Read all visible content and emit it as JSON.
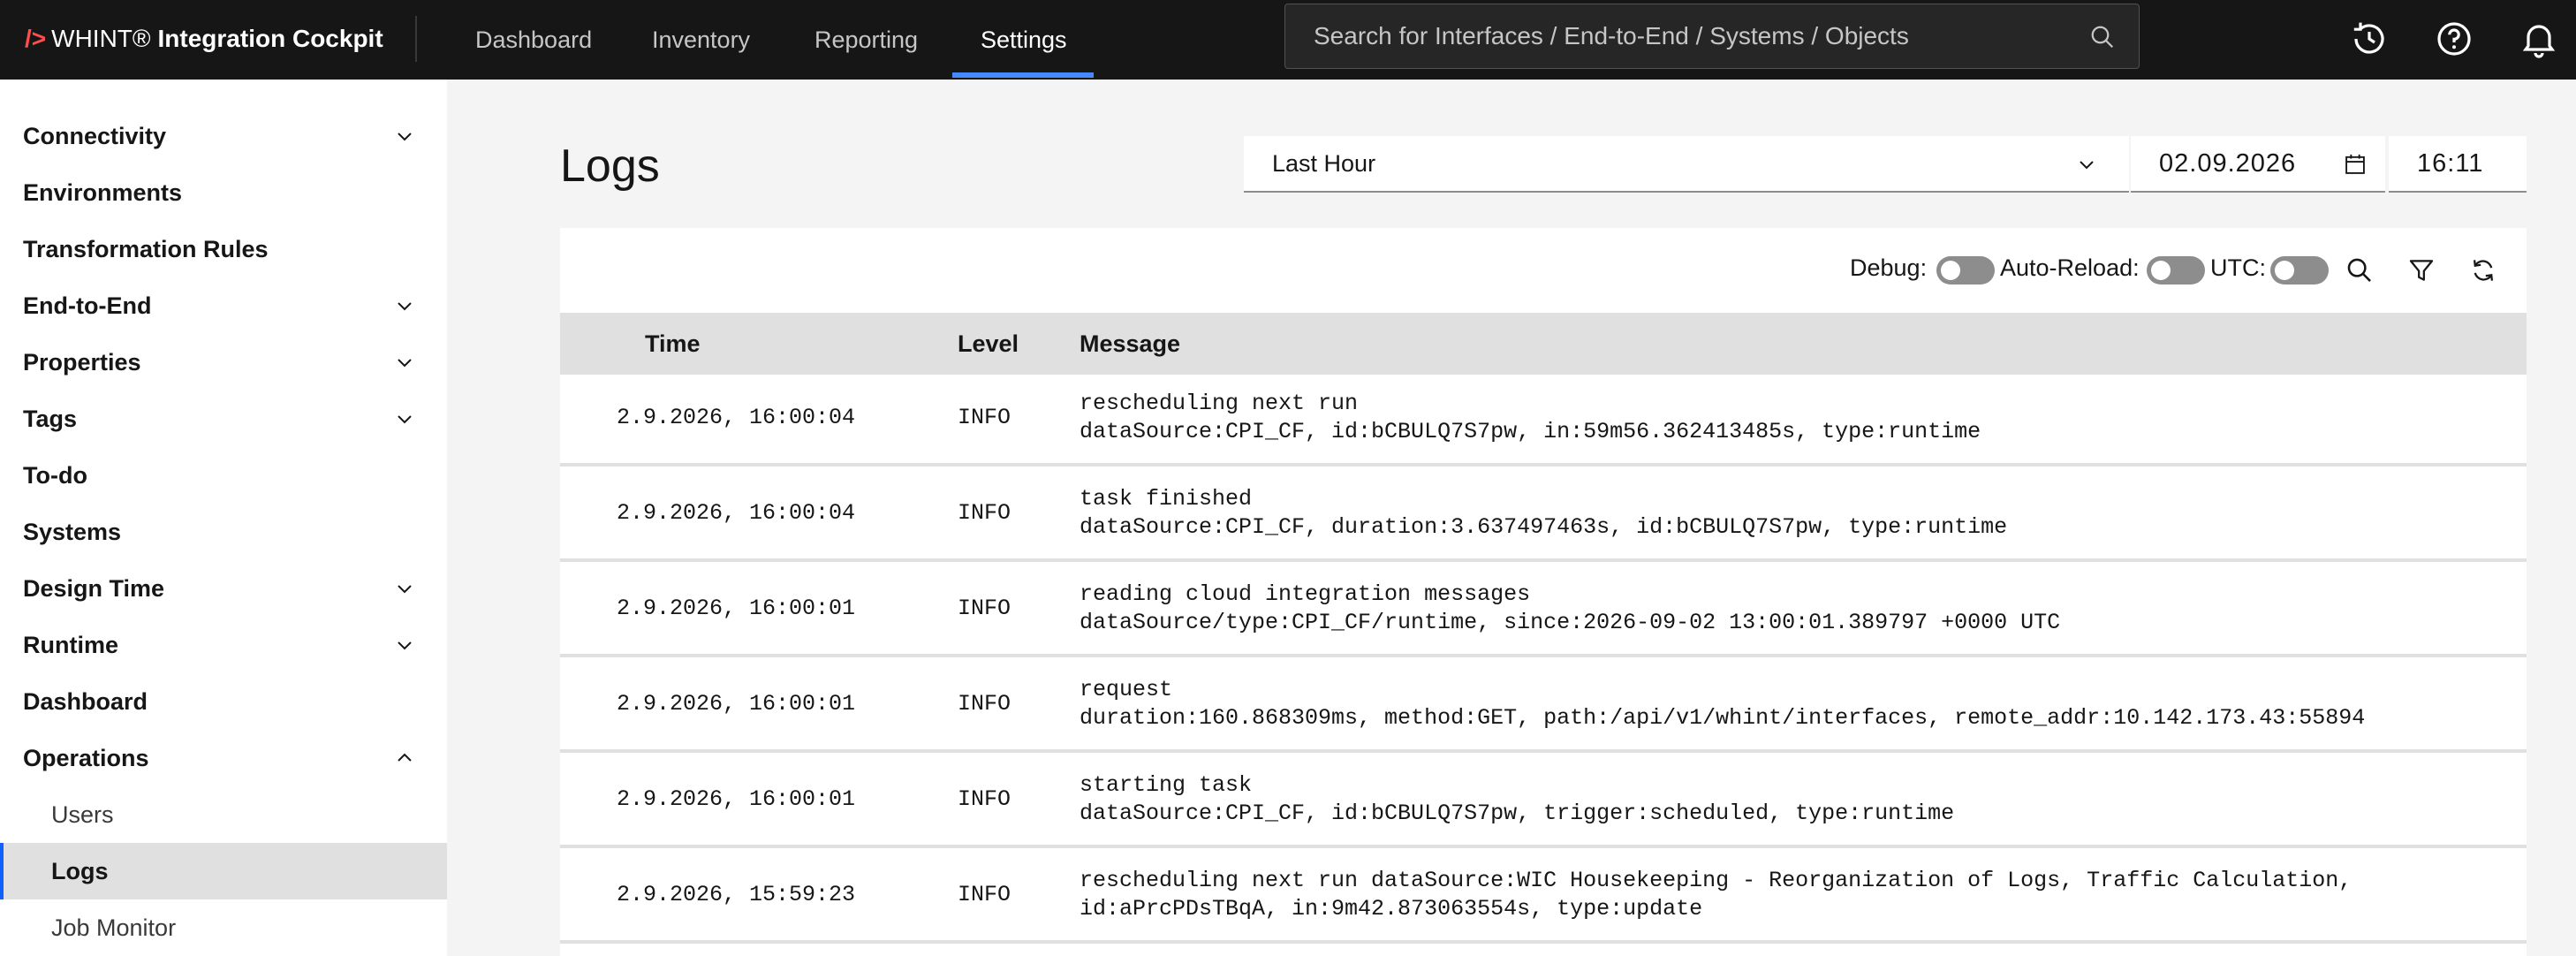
{
  "header": {
    "brand_prefix": "/>",
    "brand_name": "WHINT® ",
    "brand_product": "Integration Cockpit",
    "nav": [
      "Dashboard",
      "Inventory",
      "Reporting",
      "Settings"
    ],
    "active_nav": "Settings",
    "search_placeholder": "Search for Interfaces / End-to-End / Systems / Objects",
    "icons": [
      "history-icon",
      "help-icon",
      "notification-icon"
    ]
  },
  "sidebar": {
    "items": [
      {
        "label": "Connectivity",
        "expandable": true,
        "expanded": false
      },
      {
        "label": "Environments"
      },
      {
        "label": "Transformation Rules"
      },
      {
        "label": "End-to-End",
        "expandable": true,
        "expanded": false
      },
      {
        "label": "Properties",
        "expandable": true,
        "expanded": false
      },
      {
        "label": "Tags",
        "expandable": true,
        "expanded": false
      },
      {
        "label": "To-do"
      },
      {
        "label": "Systems"
      },
      {
        "label": "Design Time",
        "expandable": true,
        "expanded": false
      },
      {
        "label": "Runtime",
        "expandable": true,
        "expanded": false
      },
      {
        "label": "Dashboard"
      },
      {
        "label": "Operations",
        "expandable": true,
        "expanded": true
      },
      {
        "label": "Users",
        "sub": true
      },
      {
        "label": "Logs",
        "sub": true,
        "active": true
      },
      {
        "label": "Job Monitor",
        "sub": true
      }
    ]
  },
  "main": {
    "title": "Logs",
    "range_value": "Last Hour",
    "date_value": "02.09.2026",
    "time_value": "16:11",
    "toolbar": {
      "debug_label": "Debug:",
      "autoreload_label": "Auto-Reload:",
      "utc_label": "UTC:",
      "debug_on": false,
      "autoreload_on": false,
      "utc_on": false
    },
    "columns": [
      "Time",
      "Level",
      "Message"
    ],
    "rows": [
      {
        "time": "2.9.2026, 16:00:04",
        "level": "INFO",
        "msg1": "rescheduling next run",
        "msg2": "dataSource:CPI_CF, id:bCBULQ7S7pw, in:59m56.362413485s, type:runtime"
      },
      {
        "time": "2.9.2026, 16:00:04",
        "level": "INFO",
        "msg1": "task finished",
        "msg2": "dataSource:CPI_CF, duration:3.637497463s, id:bCBULQ7S7pw, type:runtime"
      },
      {
        "time": "2.9.2026, 16:00:01",
        "level": "INFO",
        "msg1": "reading cloud integration messages",
        "msg2": "dataSource/type:CPI_CF/runtime, since:2026-09-02 13:00:01.389797 +0000 UTC"
      },
      {
        "time": "2.9.2026, 16:00:01",
        "level": "INFO",
        "msg1": "request",
        "msg2": "duration:160.868309ms, method:GET, path:/api/v1/whint/interfaces, remote_addr:10.142.173.43:55894"
      },
      {
        "time": "2.9.2026, 16:00:01",
        "level": "INFO",
        "msg1": "starting task",
        "msg2": "dataSource:CPI_CF, id:bCBULQ7S7pw, trigger:scheduled, type:runtime"
      },
      {
        "time": "2.9.2026, 15:59:23",
        "level": "INFO",
        "msg1": "rescheduling next run dataSource:WIC Housekeeping - Reorganization of Logs, Traffic Calculation,",
        "msg2": "id:aPrcPDsTBqA, in:9m42.873063554s, type:update"
      }
    ]
  }
}
